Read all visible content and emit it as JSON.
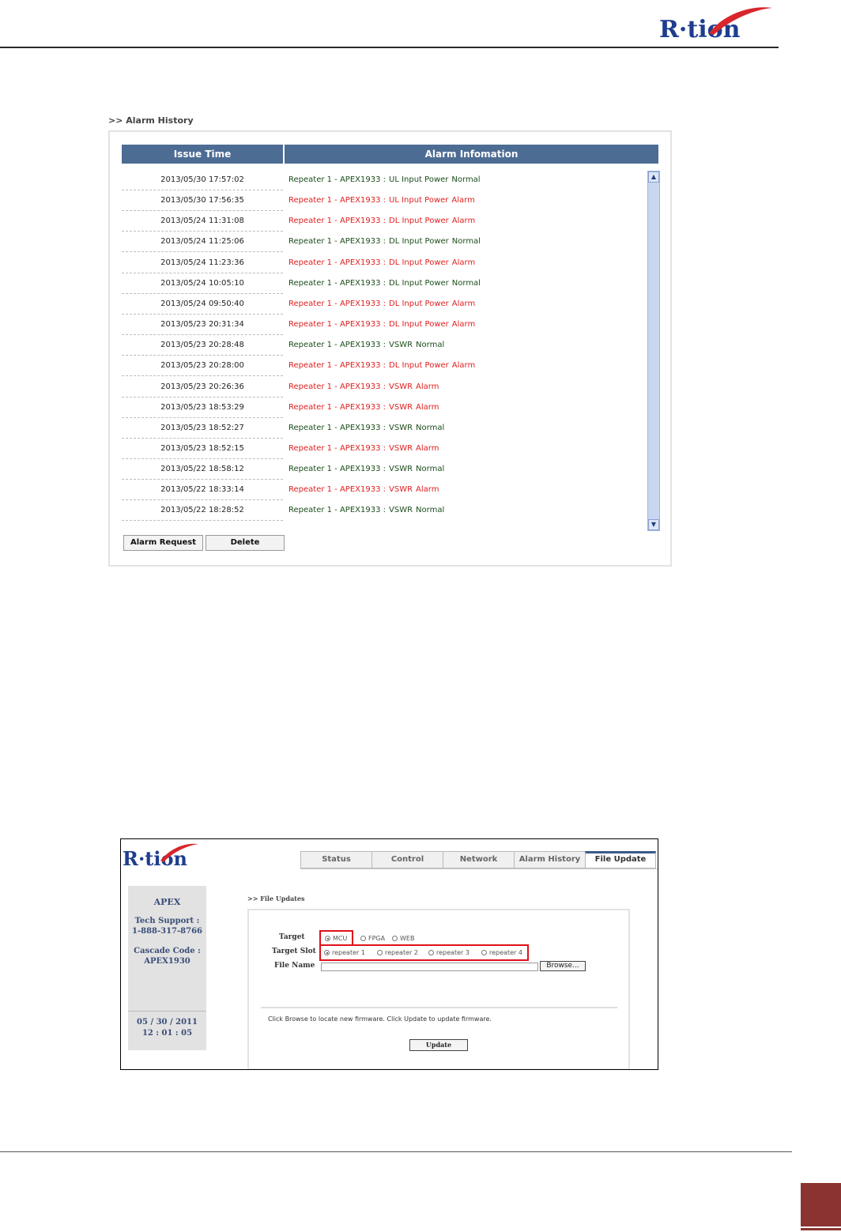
{
  "brand": {
    "logo": "R·tion"
  },
  "alarm_history": {
    "breadcrumb": ">> Alarm History",
    "columns": [
      "Issue Time",
      "Alarm Infomation"
    ],
    "rows": [
      {
        "time": "2013/05/30 17:57:02",
        "source": "Repeater 1 - APEX1933 :",
        "item": "UL Input Power",
        "status": "Normal"
      },
      {
        "time": "2013/05/30 17:56:35",
        "source": "Repeater 1 - APEX1933 :",
        "item": "UL Input Power",
        "status": "Alarm"
      },
      {
        "time": "2013/05/24 11:31:08",
        "source": "Repeater 1 - APEX1933 :",
        "item": "DL Input Power",
        "status": "Alarm"
      },
      {
        "time": "2013/05/24 11:25:06",
        "source": "Repeater 1 - APEX1933 :",
        "item": "DL Input Power",
        "status": "Normal"
      },
      {
        "time": "2013/05/24 11:23:36",
        "source": "Repeater 1 - APEX1933 :",
        "item": "DL Input Power",
        "status": "Alarm"
      },
      {
        "time": "2013/05/24 10:05:10",
        "source": "Repeater 1 - APEX1933 :",
        "item": "DL Input Power",
        "status": "Normal"
      },
      {
        "time": "2013/05/24 09:50:40",
        "source": "Repeater 1 - APEX1933 :",
        "item": "DL Input Power",
        "status": "Alarm"
      },
      {
        "time": "2013/05/23 20:31:34",
        "source": "Repeater 1 - APEX1933 :",
        "item": "DL Input Power",
        "status": "Alarm"
      },
      {
        "time": "2013/05/23 20:28:48",
        "source": "Repeater 1 - APEX1933 :",
        "item": "VSWR",
        "status": "Normal"
      },
      {
        "time": "2013/05/23 20:28:00",
        "source": "Repeater 1 - APEX1933 :",
        "item": "DL Input Power",
        "status": "Alarm"
      },
      {
        "time": "2013/05/23 20:26:36",
        "source": "Repeater 1 - APEX1933 :",
        "item": "VSWR",
        "status": "Alarm"
      },
      {
        "time": "2013/05/23 18:53:29",
        "source": "Repeater 1 - APEX1933 :",
        "item": "VSWR",
        "status": "Alarm"
      },
      {
        "time": "2013/05/23 18:52:27",
        "source": "Repeater 1 - APEX1933 :",
        "item": "VSWR",
        "status": "Normal"
      },
      {
        "time": "2013/05/23 18:52:15",
        "source": "Repeater 1 - APEX1933 :",
        "item": "VSWR",
        "status": "Alarm"
      },
      {
        "time": "2013/05/22 18:58:12",
        "source": "Repeater 1 - APEX1933 :",
        "item": "VSWR",
        "status": "Normal"
      },
      {
        "time": "2013/05/22 18:33:14",
        "source": "Repeater 1 - APEX1933 :",
        "item": "VSWR",
        "status": "Alarm"
      },
      {
        "time": "2013/05/22 18:28:52",
        "source": "Repeater 1 - APEX1933 :",
        "item": "VSWR",
        "status": "Normal"
      }
    ],
    "buttons": {
      "alarm_request": "Alarm Request",
      "delete": "Delete"
    },
    "colors": {
      "header_bg": "#4d6c93",
      "normal": "#1b4d1b",
      "alarm": "#e02020"
    }
  },
  "file_update": {
    "tabs": [
      "Status",
      "Control",
      "Network",
      "Alarm History",
      "File Update"
    ],
    "active_tab": "File Update",
    "sidebar": {
      "product": "APEX",
      "support_label": "Tech Support :",
      "support_phone": "1-888-317-8766",
      "cascade_label": "Cascade Code :",
      "cascade_code": "APEX1930",
      "date": "05 / 30 / 2011",
      "time": "12 : 01 : 05"
    },
    "breadcrumb": ">> File Updates",
    "target_label": "Target",
    "target_options": [
      "MCU",
      "FPGA",
      "WEB"
    ],
    "target_selected": "MCU",
    "slot_label": "Target Slot",
    "slot_options": [
      "repeater 1",
      "repeater 2",
      "repeater 3",
      "repeater 4"
    ],
    "slot_selected": "repeater 1",
    "file_label": "File Name",
    "browse_label": "Browse...",
    "instruction": "Click Browse to locate new firmware. Click Update to update firmware.",
    "update_label": "Update",
    "highlight_color": "#e0101a"
  }
}
